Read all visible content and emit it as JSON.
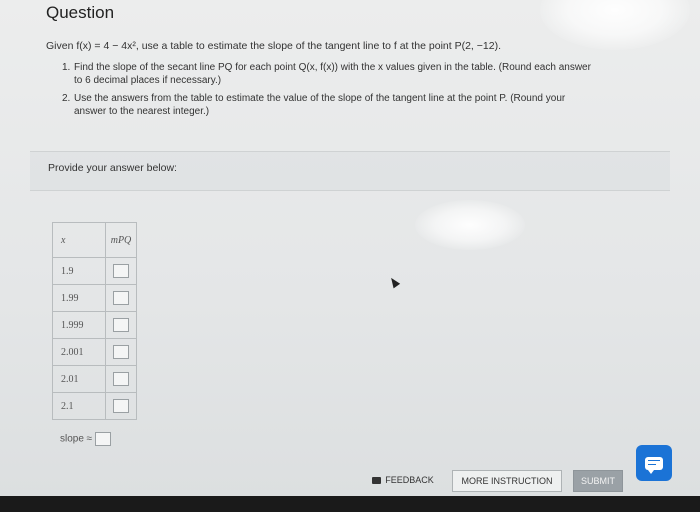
{
  "header": {
    "title": "Question"
  },
  "question": {
    "given_prefix": "Given ",
    "function": "f(x) = 4 − 4x², use a table to estimate the slope of the tangent line to f at the point P(2, −12).",
    "instructions": [
      {
        "num": "1.",
        "text": "Find the slope of the secant line PQ for each point Q(x, f(x)) with the x values given in the table. (Round each answer",
        "cont": "to 6 decimal places if necessary.)"
      },
      {
        "num": "2.",
        "text": "Use the answers from the table to estimate the value of the slope of the tangent line at the point P. (Round your",
        "cont": "answer to the nearest integer.)"
      }
    ]
  },
  "answer_section": {
    "prompt": "Provide your answer below:",
    "table": {
      "headers": [
        "x",
        "mPQ"
      ],
      "rows": [
        {
          "x": "1.9",
          "m_pq": ""
        },
        {
          "x": "1.99",
          "m_pq": ""
        },
        {
          "x": "1.999",
          "m_pq": ""
        },
        {
          "x": "2.001",
          "m_pq": ""
        },
        {
          "x": "2.01",
          "m_pq": ""
        },
        {
          "x": "2.1",
          "m_pq": ""
        }
      ]
    },
    "slope_label": "slope ≈",
    "slope_value": ""
  },
  "footer": {
    "feedback_label": "FEEDBACK",
    "more_instruction_label": "MORE INSTRUCTION",
    "submit_label": "SUBMIT"
  },
  "icons": {
    "feedback": "feedback-icon",
    "chat": "chat-icon",
    "cursor": "mouse-cursor-icon"
  },
  "colors": {
    "chat_button": "#1b73d6",
    "submit_button": "#9aa1a6"
  }
}
